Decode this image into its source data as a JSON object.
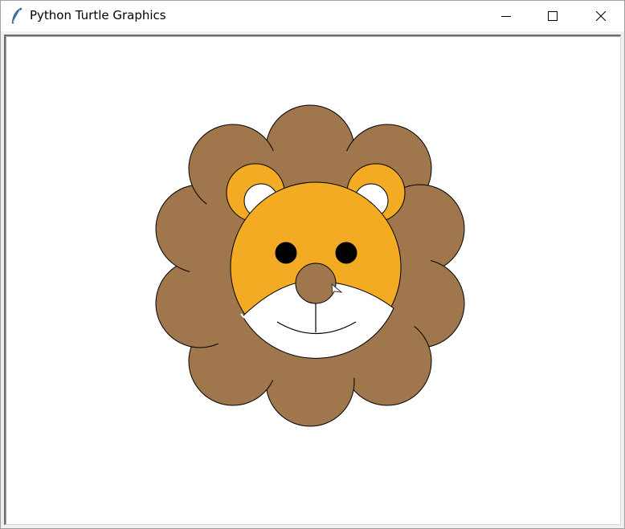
{
  "window": {
    "title": "Python Turtle Graphics",
    "app_icon": "feather-icon",
    "controls": {
      "minimize_icon": "minimize-icon",
      "maximize_icon": "maximize-icon",
      "close_icon": "close-icon"
    }
  },
  "canvas": {
    "background": "#ffffff",
    "drawing": "lion-face",
    "colors": {
      "mane": "#a0764c",
      "face": "#f2ab22",
      "ear_inner": "#ffffff",
      "muzzle": "#ffffff",
      "eyes": "#000000",
      "nose": "#a0764c",
      "outline": "#000000"
    },
    "turtle_cursor": "arrow-turtle-icon"
  }
}
